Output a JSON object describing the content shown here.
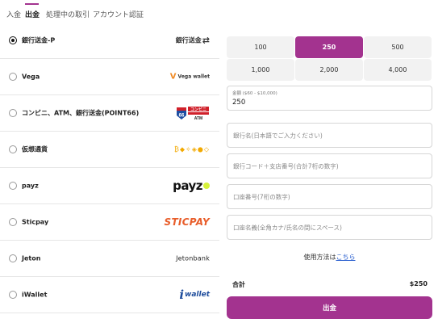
{
  "tabs": [
    {
      "label": "入金",
      "active": false
    },
    {
      "label": "出金",
      "active": true
    },
    {
      "label": "処理中の取引",
      "active": false
    },
    {
      "label": "アカウント認証",
      "active": false
    }
  ],
  "methods": [
    {
      "label": "銀行送金-P",
      "selected": true,
      "logo_text": "銀行送金",
      "logo_symbol": "⇄"
    },
    {
      "label": "Vega",
      "selected": false,
      "logo_text": "Vega wallet",
      "logo_symbol": "V"
    },
    {
      "label": "コンビニ、ATM、銀行送金(POINT66)",
      "selected": false,
      "logo_text": "コンビニ",
      "logo_subtext": "ATM",
      "logo_number": "66"
    },
    {
      "label": "仮想通貨",
      "selected": false,
      "logo_text": "₿◆✧◈●◇"
    },
    {
      "label": "payz",
      "selected": false,
      "logo_text": "payz"
    },
    {
      "label": "Sticpay",
      "selected": false,
      "logo_text": "STICPAY"
    },
    {
      "label": "Jeton",
      "selected": false,
      "logo_text": "Jetonbank"
    },
    {
      "label": "iWallet",
      "selected": false,
      "logo_text": "wallet",
      "logo_symbol": "i"
    }
  ],
  "amounts": [
    {
      "label": "100",
      "selected": false
    },
    {
      "label": "250",
      "selected": true
    },
    {
      "label": "500",
      "selected": false
    },
    {
      "label": "1,000",
      "selected": false
    },
    {
      "label": "2,000",
      "selected": false
    },
    {
      "label": "4,000",
      "selected": false
    }
  ],
  "amount_field": {
    "label": "金額 ($60 - $10,000)",
    "value": "250"
  },
  "fields": [
    {
      "placeholder": "銀行名(日本語でご入力ください)"
    },
    {
      "placeholder": "銀行コード＋支店番号(合計7桁の数字)"
    },
    {
      "placeholder": "口座番号(7桁の数字)"
    },
    {
      "placeholder": "口座名義(全角カナ/氏名の間にスペース)"
    }
  ],
  "howto": {
    "prefix": "使用方法は",
    "link": "こちら"
  },
  "total": {
    "label": "合計",
    "value": "$250"
  },
  "submit_label": "出金",
  "colors": {
    "accent": "#a3338f",
    "link": "#2a5fcf",
    "sticpay": "#e85d2a",
    "vega": "#f08a24",
    "payz_dot": "#d6f23b"
  }
}
